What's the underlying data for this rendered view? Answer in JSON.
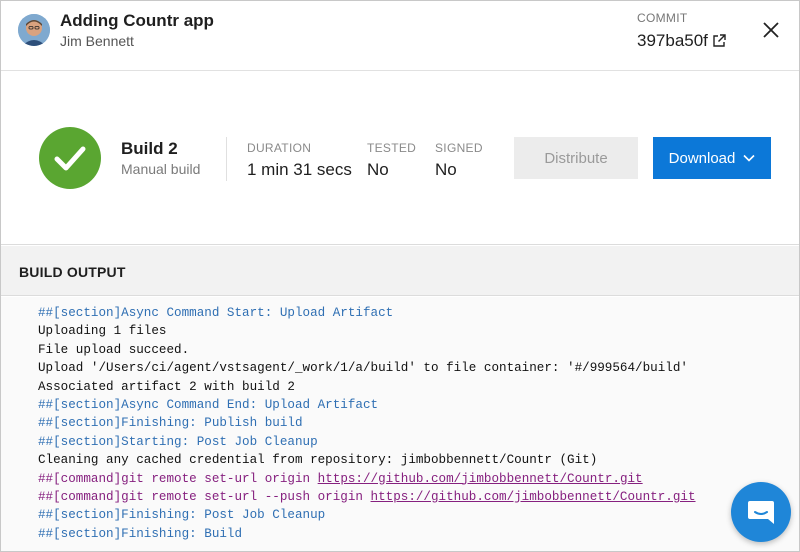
{
  "header": {
    "app_title": "Adding Countr app",
    "author": "Jim Bennett",
    "commit_label": "COMMIT",
    "commit_hash": "397ba50f"
  },
  "summary": {
    "build_name": "Build 2",
    "build_type": "Manual build",
    "duration_label": "DURATION",
    "duration_value": "1 min 31 secs",
    "tested_label": "TESTED",
    "tested_value": "No",
    "signed_label": "SIGNED",
    "signed_value": "No",
    "distribute_label": "Distribute",
    "download_label": "Download"
  },
  "output": {
    "title": "BUILD OUTPUT",
    "lines": [
      {
        "kind": "section",
        "parts": [
          {
            "t": "##[section]Async Command Start: Upload Artifact"
          }
        ]
      },
      {
        "kind": "plain",
        "parts": [
          {
            "t": "Uploading 1 files"
          }
        ]
      },
      {
        "kind": "plain",
        "parts": [
          {
            "t": "File upload succeed."
          }
        ]
      },
      {
        "kind": "plain",
        "parts": [
          {
            "t": "Upload '/Users/ci/agent/vstsagent/_work/1/a/build' to file container: '#/999564/build'"
          }
        ]
      },
      {
        "kind": "plain",
        "parts": [
          {
            "t": "Associated artifact 2 with build 2"
          }
        ]
      },
      {
        "kind": "section",
        "parts": [
          {
            "t": "##[section]Async Command End: Upload Artifact"
          }
        ]
      },
      {
        "kind": "section",
        "parts": [
          {
            "t": "##[section]Finishing: Publish build"
          }
        ]
      },
      {
        "kind": "section",
        "parts": [
          {
            "t": "##[section]Starting: Post Job Cleanup"
          }
        ]
      },
      {
        "kind": "plain",
        "parts": [
          {
            "t": "Cleaning any cached credential from repository: jimbobbennett/Countr (Git)"
          }
        ]
      },
      {
        "kind": "command",
        "parts": [
          {
            "t": "##[command]git remote set-url origin "
          },
          {
            "t": "https://github.com/jimbobbennett/Countr.git",
            "link": true
          }
        ]
      },
      {
        "kind": "command",
        "parts": [
          {
            "t": "##[command]git remote set-url --push origin "
          },
          {
            "t": "https://github.com/jimbobbennett/Countr.git",
            "link": true
          }
        ]
      },
      {
        "kind": "section",
        "parts": [
          {
            "t": "##[section]Finishing: Post Job Cleanup"
          }
        ]
      },
      {
        "kind": "section",
        "parts": [
          {
            "t": "##[section]Finishing: Build"
          }
        ]
      }
    ]
  },
  "colors": {
    "success": "#5aa631",
    "primary": "#0c78d8",
    "section_text": "#2f6fb3",
    "command_text": "#86207f"
  },
  "icons": {
    "close": "close-icon",
    "external": "external-link-icon",
    "status": "checkmark-icon",
    "dropdown": "chevron-down-icon",
    "chat": "chat-icon"
  }
}
